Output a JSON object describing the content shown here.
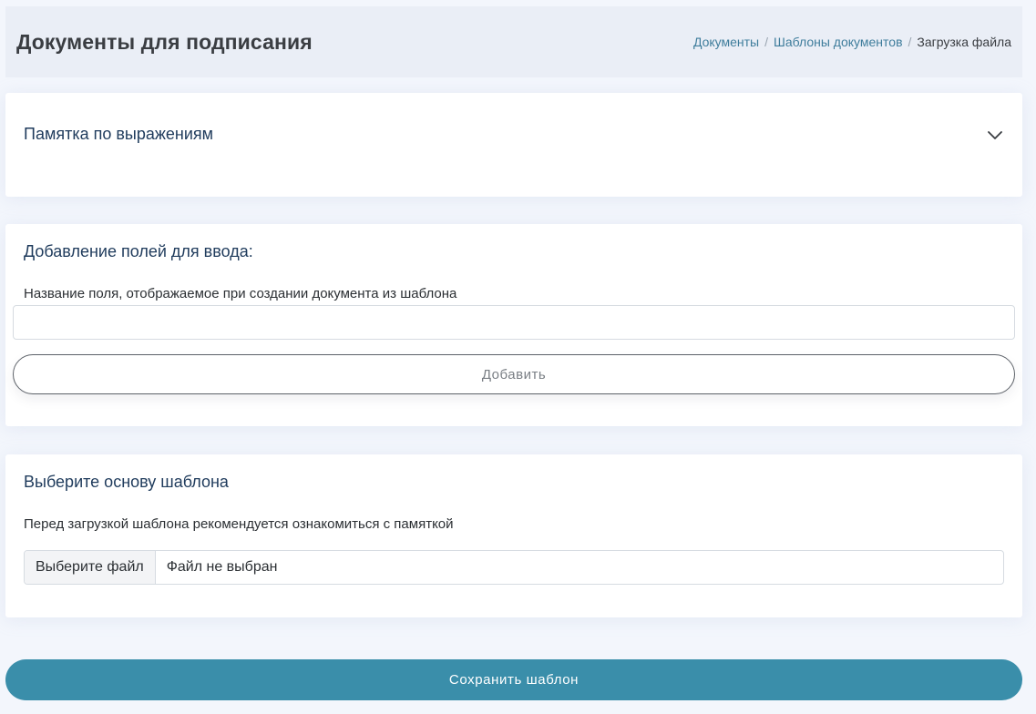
{
  "header": {
    "title": "Документы для подписания",
    "breadcrumb": [
      {
        "label": "Документы"
      },
      {
        "label": "Шаблоны документов"
      },
      {
        "label": "Загрузка файла"
      }
    ],
    "separator": "/"
  },
  "memo": {
    "title": "Памятка по выражениям",
    "icon": "chevron-down-icon"
  },
  "fields_section": {
    "title": "Добавление полей для ввода:",
    "field_label": "Название поля, отображаемое при создании документа из шаблона",
    "field_value": "",
    "add_button_label": "Добавить"
  },
  "template_section": {
    "title": "Выберите основу шаблона",
    "note": "Перед загрузкой шаблона рекомендуется ознакомиться с памяткой",
    "file_button_label": "Выберите файл",
    "file_status": "Файл не выбран"
  },
  "footer": {
    "save_button_label": "Сохранить шаблон"
  },
  "colors": {
    "accent": "#3a8eaa",
    "link": "#3f7d9c",
    "heading": "#1f3b5c",
    "header_bg": "#eaeef6",
    "page_bg": "#f3f6fc"
  }
}
